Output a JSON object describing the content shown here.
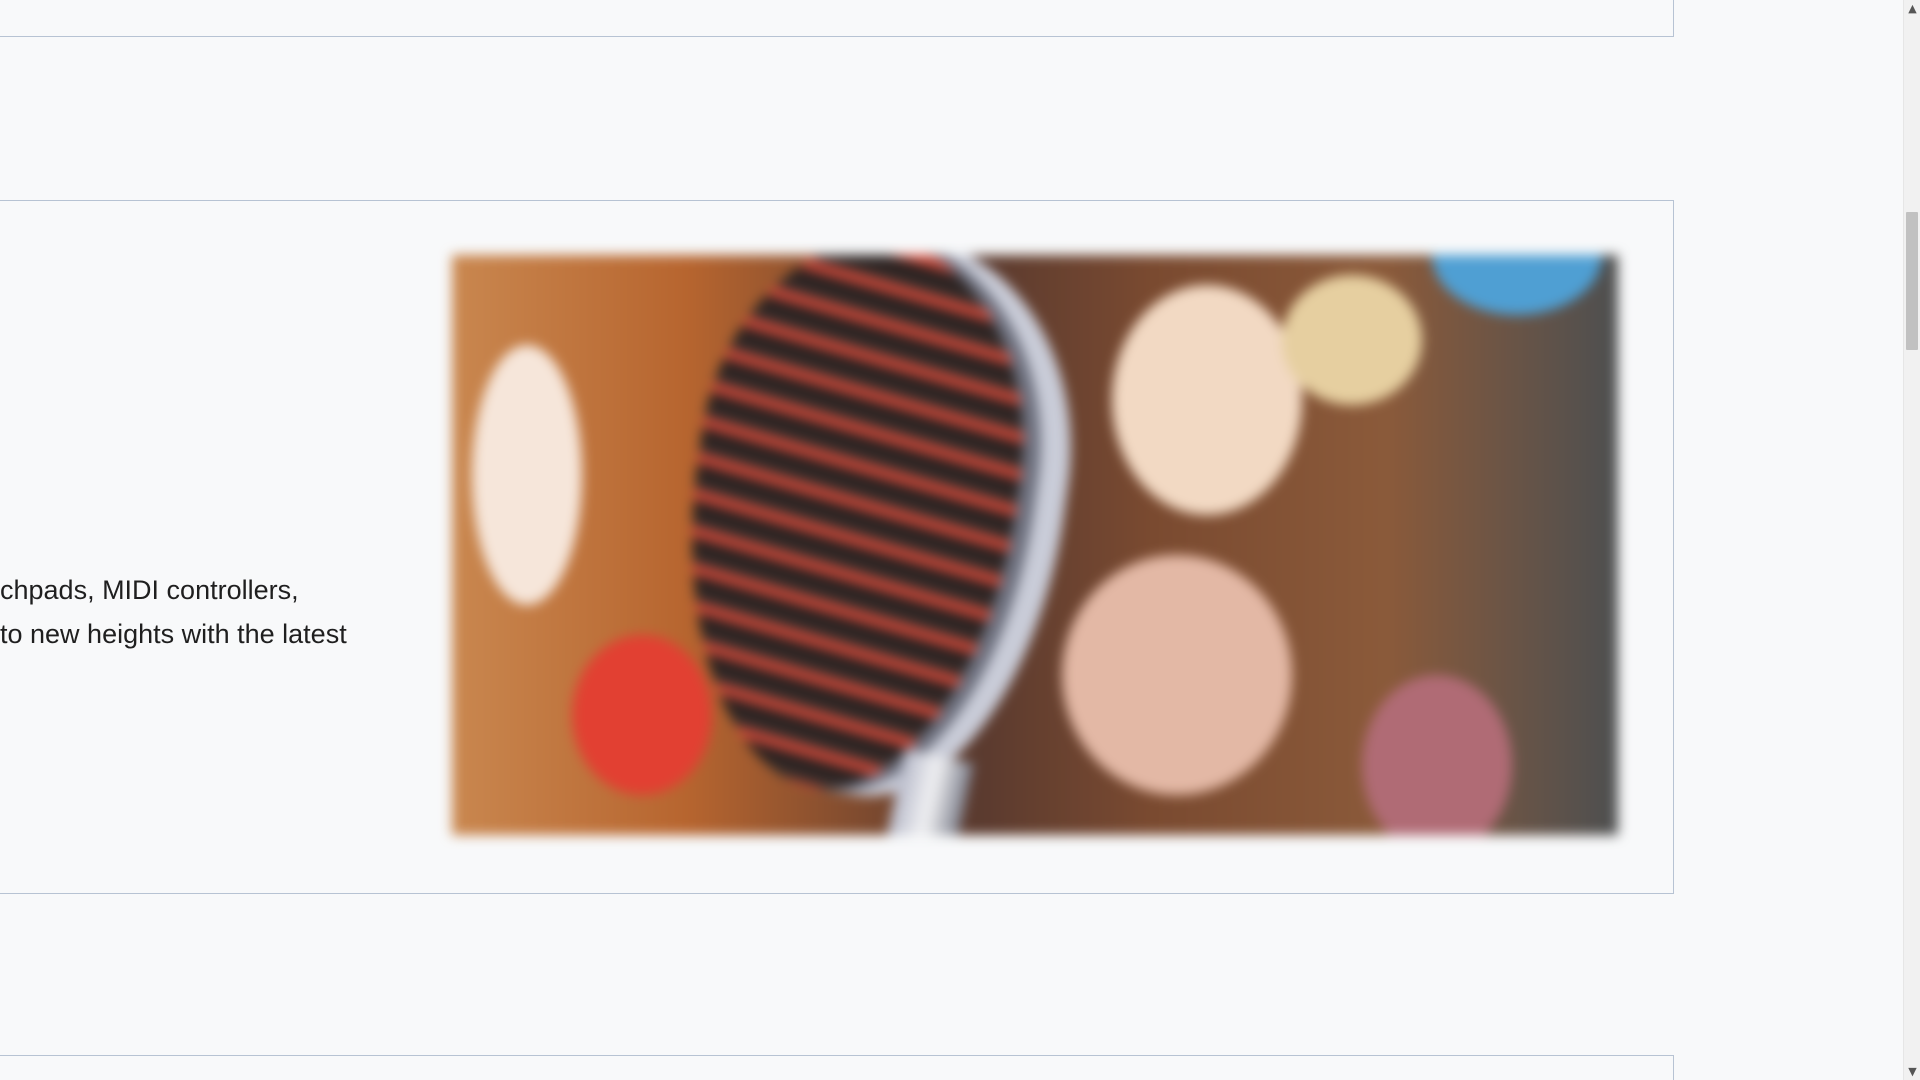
{
  "feature": {
    "line1": "chpads, MIDI controllers,",
    "line2": "to new heights with the latest"
  },
  "image": {
    "subject": "vintage microphone with bokeh lights"
  },
  "scrollbar": {
    "up_glyph": "▲",
    "down_glyph": "▼"
  },
  "colors": {
    "page_background": "#f8f9fa",
    "card_border": "#b7c3d3",
    "text": "#1f1f1f"
  }
}
